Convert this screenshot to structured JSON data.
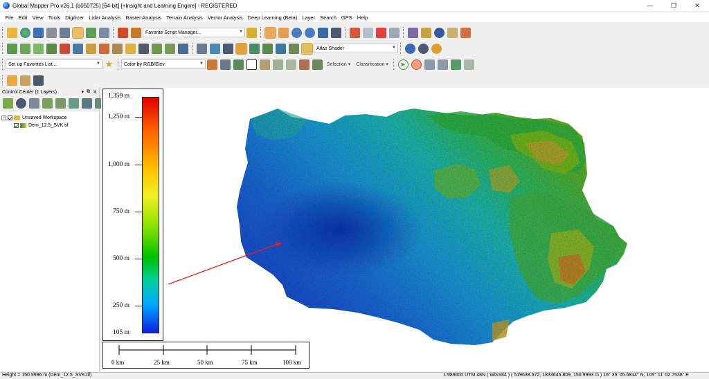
{
  "window": {
    "title": "Global Mapper Pro v26.1 (b050725) [64-bit] [+Insight and Learning Engine] - REGISTERED",
    "minimize": "—",
    "maximize": "❐",
    "close": "✕"
  },
  "menu": [
    "File",
    "Edit",
    "View",
    "Tools",
    "Digitizer",
    "Lidar Analysis",
    "Raster Analysis",
    "Terrain Analysis",
    "Vector Analysis",
    "Deep Learning (Beta)",
    "Layer",
    "Search",
    "GPS",
    "Help"
  ],
  "toolbars": {
    "favorite_script": "Favorite Script Manager...",
    "shader": "Atlas Shader",
    "favorites_list": "Set up Favorites List...",
    "color_mode": "Color by RGB/Elev",
    "selection": "Selection",
    "classification": "Classification"
  },
  "control_center": {
    "title": "Control Center (1 Layers)",
    "pin": "▾",
    "float": "⧉",
    "close": "✕",
    "workspace": "Unsaved Workspace",
    "layer": "Dem_12.5_SVK.tif"
  },
  "legend": {
    "labels": [
      "1,359 m",
      "1,250 m",
      "1,000 m",
      "750 m",
      "500 m",
      "250 m",
      "105 m"
    ],
    "values": [
      1359,
      1250,
      1000,
      750,
      500,
      250,
      105
    ]
  },
  "scale_bar": {
    "labels": [
      "0 km",
      "25 km",
      "50 km",
      "75 km",
      "100 km"
    ]
  },
  "status": {
    "left": "Height = 150.9996 m (Dem_12.5_SVK.tif)",
    "right": "1:989000  UTM 48N ( WGS84 ) ( 519638.672, 1833645.809, 150.9993 m )  16° 35' 05.6814\" N, 105° 11' 02.7538\" E"
  },
  "colors": {
    "accent_selected": "#fbe6b8",
    "pointer_arrow": "#e02020"
  }
}
